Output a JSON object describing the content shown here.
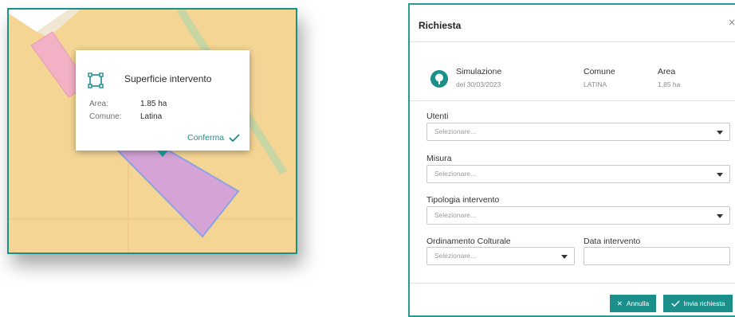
{
  "map": {
    "popup": {
      "title": "Superficie intervento",
      "rows": [
        {
          "key": "Area:",
          "value": "1.85 ha"
        },
        {
          "key": "Comune:",
          "value": "Latina"
        }
      ],
      "confirm_label": "Conferma",
      "icon": "polygon-area-icon"
    },
    "colors": {
      "background": "#f5d594",
      "parcel": "#d5a3d6",
      "parcel_stroke": "#8aa3e6",
      "pink_area": "#f2b1c4",
      "road": "#c8d6a3",
      "accent": "#1b8f8a"
    }
  },
  "dialog": {
    "title": "Richiesta",
    "close_glyph": "×",
    "info": {
      "simulazione": {
        "label": "Simulazione",
        "sub": "del 30/03/2023"
      },
      "comune": {
        "label": "Comune",
        "sub": "LATINA"
      },
      "area": {
        "label": "Area",
        "sub": "1,85 ha"
      }
    },
    "fields": {
      "utenti": {
        "label": "Utenti",
        "placeholder": "Selezionare..."
      },
      "misura": {
        "label": "Misura",
        "placeholder": "Selezionare..."
      },
      "tipologia": {
        "label": "Tipologia intervento",
        "placeholder": "Selezionare..."
      },
      "ordinamento": {
        "label": "Ordinamento Colturale",
        "placeholder": "Selezionare..."
      },
      "data": {
        "label": "Data intervento",
        "value": ""
      }
    },
    "buttons": {
      "annulla": "Annulla",
      "invia": "Invia richiesta"
    },
    "accent": "#1b8f8a"
  }
}
